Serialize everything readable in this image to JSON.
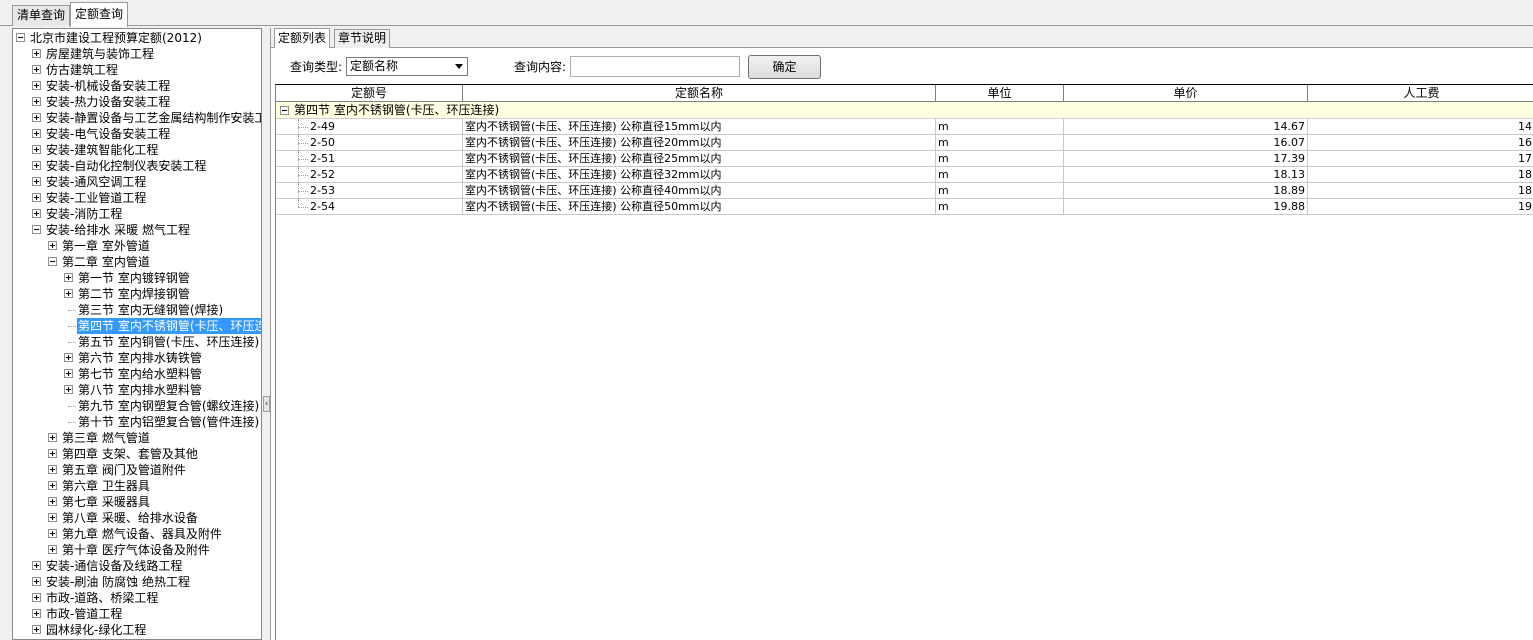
{
  "top_tabs": [
    {
      "label": "清单查询",
      "active": false
    },
    {
      "label": "定额查询",
      "active": true
    }
  ],
  "tree": {
    "root": "北京市建设工程预算定额(2012)",
    "items": [
      {
        "label": "房屋建筑与装饰工程",
        "level": 1,
        "state": "collapsed"
      },
      {
        "label": "仿古建筑工程",
        "level": 1,
        "state": "collapsed"
      },
      {
        "label": "安装-机械设备安装工程",
        "level": 1,
        "state": "collapsed"
      },
      {
        "label": "安装-热力设备安装工程",
        "level": 1,
        "state": "collapsed"
      },
      {
        "label": "安装-静置设备与工艺金属结构制作安装工",
        "level": 1,
        "state": "collapsed"
      },
      {
        "label": "安装-电气设备安装工程",
        "level": 1,
        "state": "collapsed"
      },
      {
        "label": "安装-建筑智能化工程",
        "level": 1,
        "state": "collapsed"
      },
      {
        "label": "安装-自动化控制仪表安装工程",
        "level": 1,
        "state": "collapsed"
      },
      {
        "label": "安装-通风空调工程",
        "level": 1,
        "state": "collapsed"
      },
      {
        "label": "安装-工业管道工程",
        "level": 1,
        "state": "collapsed"
      },
      {
        "label": "安装-消防工程",
        "level": 1,
        "state": "collapsed"
      },
      {
        "label": "安装-给排水 采暖 燃气工程",
        "level": 1,
        "state": "expanded"
      },
      {
        "label": "第一章 室外管道",
        "level": 2,
        "state": "collapsed"
      },
      {
        "label": "第二章 室内管道",
        "level": 2,
        "state": "expanded"
      },
      {
        "label": "第一节 室内镀锌钢管",
        "level": 3,
        "state": "collapsed"
      },
      {
        "label": "第二节 室内焊接钢管",
        "level": 3,
        "state": "collapsed"
      },
      {
        "label": "第三节 室内无缝钢管(焊接)",
        "level": 3,
        "state": "leaf"
      },
      {
        "label": "第四节 室内不锈钢管(卡压、环压连",
        "level": 3,
        "state": "leaf",
        "selected": true
      },
      {
        "label": "第五节 室内铜管(卡压、环压连接)",
        "level": 3,
        "state": "leaf"
      },
      {
        "label": "第六节 室内排水铸铁管",
        "level": 3,
        "state": "collapsed"
      },
      {
        "label": "第七节 室内给水塑料管",
        "level": 3,
        "state": "collapsed"
      },
      {
        "label": "第八节 室内排水塑料管",
        "level": 3,
        "state": "collapsed"
      },
      {
        "label": "第九节 室内钢塑复合管(螺纹连接)",
        "level": 3,
        "state": "leaf"
      },
      {
        "label": "第十节 室内铝塑复合管(管件连接)",
        "level": 3,
        "state": "leaf"
      },
      {
        "label": "第三章 燃气管道",
        "level": 2,
        "state": "collapsed"
      },
      {
        "label": "第四章 支架、套管及其他",
        "level": 2,
        "state": "collapsed"
      },
      {
        "label": "第五章 阀门及管道附件",
        "level": 2,
        "state": "collapsed"
      },
      {
        "label": "第六章 卫生器具",
        "level": 2,
        "state": "collapsed"
      },
      {
        "label": "第七章 采暖器具",
        "level": 2,
        "state": "collapsed"
      },
      {
        "label": "第八章 采暖、给排水设备",
        "level": 2,
        "state": "collapsed"
      },
      {
        "label": "第九章 燃气设备、器具及附件",
        "level": 2,
        "state": "collapsed"
      },
      {
        "label": "第十章 医疗气体设备及附件",
        "level": 2,
        "state": "collapsed"
      },
      {
        "label": "安装-通信设备及线路工程",
        "level": 1,
        "state": "collapsed"
      },
      {
        "label": "安装-刷油 防腐蚀 绝热工程",
        "level": 1,
        "state": "collapsed"
      },
      {
        "label": "市政-道路、桥梁工程",
        "level": 1,
        "state": "collapsed"
      },
      {
        "label": "市政-管道工程",
        "level": 1,
        "state": "collapsed"
      },
      {
        "label": "园林绿化-绿化工程",
        "level": 1,
        "state": "collapsed"
      }
    ]
  },
  "sub_tabs": [
    {
      "label": "定额列表",
      "active": true
    },
    {
      "label": "章节说明",
      "active": false
    }
  ],
  "query": {
    "type_label": "查询类型:",
    "type_value": "定额名称",
    "content_label": "查询内容:",
    "content_value": "",
    "confirm_label": "确定"
  },
  "grid": {
    "columns": [
      "定额号",
      "定额名称",
      "单位",
      "单价",
      "人工费"
    ],
    "group_label": "第四节 室内不锈钢管(卡压、环压连接)",
    "rows": [
      {
        "code": "2-49",
        "name": "室内不锈钢管(卡压、环压连接) 公称直径15mm以内",
        "unit": "m",
        "price": "14.67",
        "labor": "14"
      },
      {
        "code": "2-50",
        "name": "室内不锈钢管(卡压、环压连接) 公称直径20mm以内",
        "unit": "m",
        "price": "16.07",
        "labor": "16"
      },
      {
        "code": "2-51",
        "name": "室内不锈钢管(卡压、环压连接) 公称直径25mm以内",
        "unit": "m",
        "price": "17.39",
        "labor": "17"
      },
      {
        "code": "2-52",
        "name": "室内不锈钢管(卡压、环压连接) 公称直径32mm以内",
        "unit": "m",
        "price": "18.13",
        "labor": "18"
      },
      {
        "code": "2-53",
        "name": "室内不锈钢管(卡压、环压连接) 公称直径40mm以内",
        "unit": "m",
        "price": "18.89",
        "labor": "18"
      },
      {
        "code": "2-54",
        "name": "室内不锈钢管(卡压、环压连接) 公称直径50mm以内",
        "unit": "m",
        "price": "19.88",
        "labor": "19"
      }
    ]
  },
  "colors": {
    "selection": "#3399ff",
    "group_row_bg": "#ffffe1"
  }
}
